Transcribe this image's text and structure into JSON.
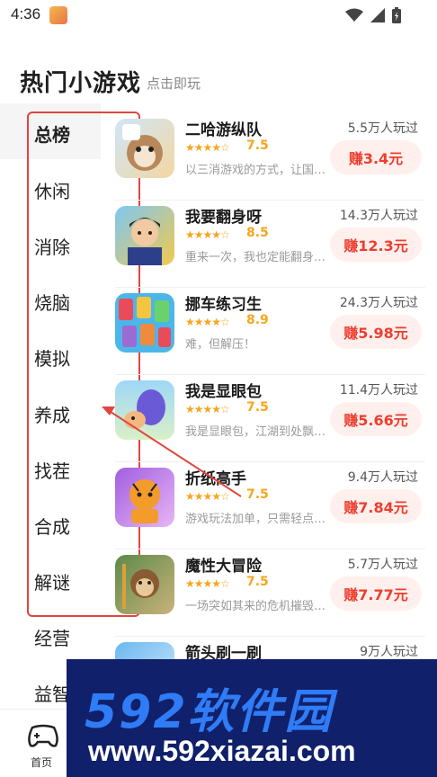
{
  "status": {
    "time": "4:36"
  },
  "header": {
    "title": "热门小游戏",
    "subtitle": "点击即玩"
  },
  "categories": [
    "总榜",
    "休闲",
    "消除",
    "烧脑",
    "模拟",
    "养成",
    "找茬",
    "合成",
    "解谜",
    "经营",
    "益智"
  ],
  "games": [
    {
      "name": "二哈游纵队",
      "plays": "5.5万人玩过",
      "rating": "7.5",
      "desc": "以三消游戏的方式，让国…",
      "earn": "赚3.4元",
      "stars": 3.5
    },
    {
      "name": "我要翻身呀",
      "plays": "14.3万人玩过",
      "rating": "8.5",
      "desc": "重来一次，我也定能翻身…",
      "earn": "赚12.3元",
      "stars": 4
    },
    {
      "name": "挪车练习生",
      "plays": "24.3万人玩过",
      "rating": "8.9",
      "desc": "难，但解压！",
      "earn": "赚5.98元",
      "stars": 4.5
    },
    {
      "name": "我是显眼包",
      "plays": "11.4万人玩过",
      "rating": "7.5",
      "desc": "我是显眼包，江湖到处飘…",
      "earn": "赚5.66元",
      "stars": 3.5
    },
    {
      "name": "折纸高手",
      "plays": "9.4万人玩过",
      "rating": "7.5",
      "desc": "游戏玩法加单，只需轻点…",
      "earn": "赚7.84元",
      "stars": 3.5
    },
    {
      "name": "魔性大冒险",
      "plays": "5.7万人玩过",
      "rating": "7.5",
      "desc": "一场突如其来的危机摧毁…",
      "earn": "赚7.77元",
      "stars": 3.5
    },
    {
      "name": "箭头刷一刷",
      "plays": "9万人玩过",
      "rating": "",
      "desc": "",
      "earn": "",
      "stars": 0
    }
  ],
  "nav": {
    "home_label": "首页"
  },
  "watermark": {
    "line1": "592软件园",
    "line2": "www.592xiazai.com"
  },
  "colors": {
    "accent": "#ef3d2e",
    "star": "#f7a51c",
    "annotation": "#e0463f"
  },
  "icons": [
    "wifi-icon",
    "signal-icon",
    "battery-icon",
    "gamepad-icon",
    "star-icon"
  ]
}
